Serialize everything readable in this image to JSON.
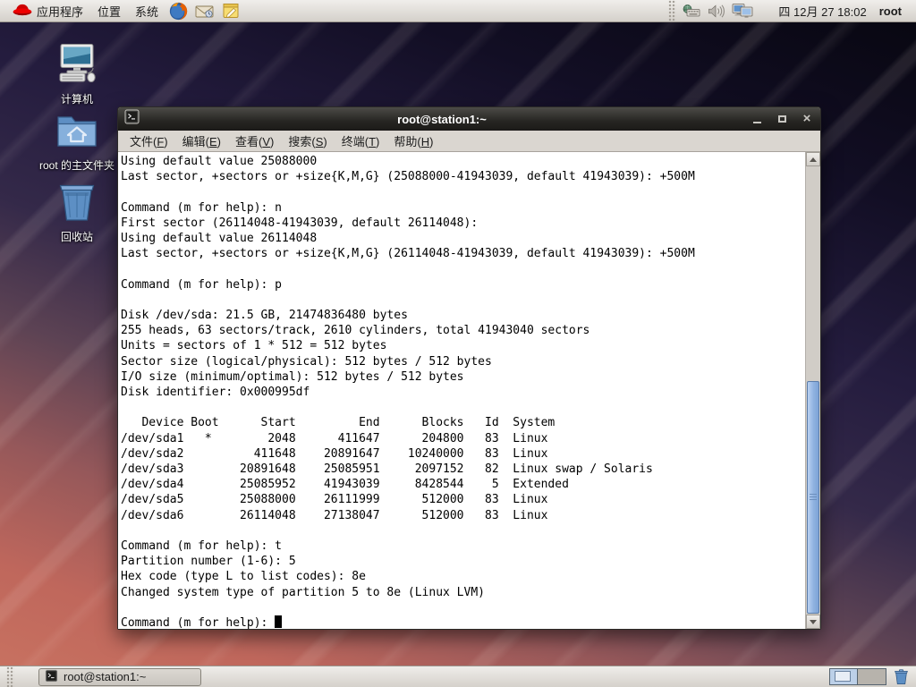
{
  "top_panel": {
    "menus": [
      {
        "label": "应用程序"
      },
      {
        "label": "位置"
      },
      {
        "label": "系统"
      }
    ],
    "clock": "四 12月 27 18:02",
    "username": "root"
  },
  "desktop_icons": [
    {
      "label": "计算机"
    },
    {
      "label": "root 的主文件夹"
    },
    {
      "label": "回收站"
    }
  ],
  "terminal": {
    "title": "root@station1:~",
    "menubar": [
      "文件(F)",
      "编辑(E)",
      "查看(V)",
      "搜索(S)",
      "终端(T)",
      "帮助(H)"
    ],
    "lines": [
      "Using default value 25088000",
      "Last sector, +sectors or +size{K,M,G} (25088000-41943039, default 41943039): +500M",
      "",
      "Command (m for help): n",
      "First sector (26114048-41943039, default 26114048): ",
      "Using default value 26114048",
      "Last sector, +sectors or +size{K,M,G} (26114048-41943039, default 41943039): +500M",
      "",
      "Command (m for help): p",
      "",
      "Disk /dev/sda: 21.5 GB, 21474836480 bytes",
      "255 heads, 63 sectors/track, 2610 cylinders, total 41943040 sectors",
      "Units = sectors of 1 * 512 = 512 bytes",
      "Sector size (logical/physical): 512 bytes / 512 bytes",
      "I/O size (minimum/optimal): 512 bytes / 512 bytes",
      "Disk identifier: 0x000995df",
      "",
      "   Device Boot      Start         End      Blocks   Id  System",
      "/dev/sda1   *        2048      411647      204800   83  Linux",
      "/dev/sda2          411648    20891647    10240000   83  Linux",
      "/dev/sda3        20891648    25085951     2097152   82  Linux swap / Solaris",
      "/dev/sda4        25085952    41943039     8428544    5  Extended",
      "/dev/sda5        25088000    26111999      512000   83  Linux",
      "/dev/sda6        26114048    27138047      512000   83  Linux",
      "",
      "Command (m for help): t",
      "Partition number (1-6): 5",
      "Hex code (type L to list codes): 8e",
      "Changed system type of partition 5 to 8e (Linux LVM)",
      "",
      "Command (m for help): "
    ]
  },
  "taskbar": {
    "window_button_label": "root@station1:~"
  },
  "colors": {
    "panel_bg": "#dcd8d2",
    "titlebar_bg": "#262522",
    "terminal_bg": "#ffffff",
    "terminal_fg": "#000000",
    "scrollbar_thumb": "#8fb2e0",
    "wallpaper_top": "#07060f",
    "wallpaper_purple": "#241c3e",
    "wallpaper_orange": "#c4685a"
  }
}
